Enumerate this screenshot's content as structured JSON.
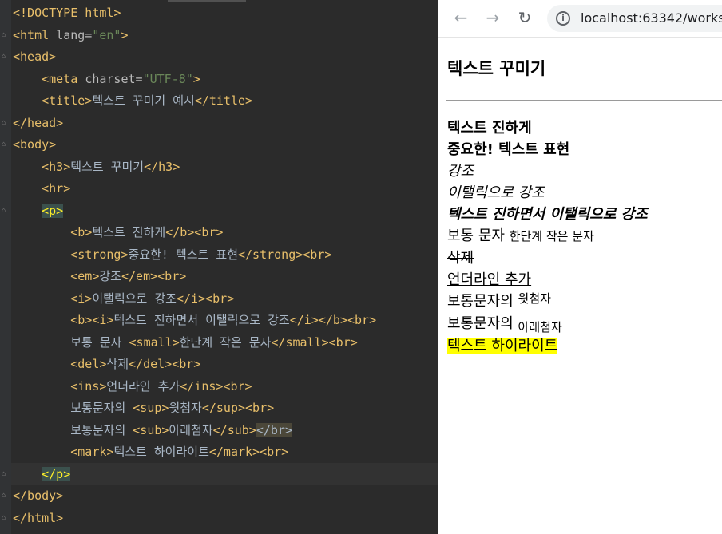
{
  "editor": {
    "lines": [
      [
        {
          "c": "tag",
          "t": "<!DOCTYPE html>"
        }
      ],
      [
        {
          "c": "tag",
          "t": "<html "
        },
        {
          "c": "attr",
          "t": "lang="
        },
        {
          "c": "val",
          "t": "\"en\""
        },
        {
          "c": "tag",
          "t": ">"
        }
      ],
      [
        {
          "c": "tag",
          "t": "<head>"
        }
      ],
      [
        {
          "c": "txt",
          "t": "    "
        },
        {
          "c": "tag",
          "t": "<meta "
        },
        {
          "c": "attr",
          "t": "charset="
        },
        {
          "c": "val",
          "t": "\"UTF-8\""
        },
        {
          "c": "tag",
          "t": ">"
        }
      ],
      [
        {
          "c": "txt",
          "t": "    "
        },
        {
          "c": "tag",
          "t": "<title>"
        },
        {
          "c": "txt",
          "t": "텍스트 꾸미기 예시"
        },
        {
          "c": "tag",
          "t": "</title>"
        }
      ],
      [
        {
          "c": "tag",
          "t": "</head>"
        }
      ],
      [
        {
          "c": "tag",
          "t": "<body>"
        }
      ],
      [
        {
          "c": "txt",
          "t": "    "
        },
        {
          "c": "tag",
          "t": "<h3>"
        },
        {
          "c": "txt",
          "t": "텍스트 꾸미기"
        },
        {
          "c": "tag",
          "t": "</h3>"
        }
      ],
      [
        {
          "c": "txt",
          "t": "    "
        },
        {
          "c": "tag",
          "t": "<hr>"
        }
      ],
      [
        {
          "c": "txt",
          "t": "    "
        },
        {
          "c": "hl-pair",
          "t": "<p>"
        }
      ],
      [
        {
          "c": "txt",
          "t": "        "
        },
        {
          "c": "tag",
          "t": "<b>"
        },
        {
          "c": "txt",
          "t": "텍스트 진하게"
        },
        {
          "c": "tag",
          "t": "</b><br>"
        }
      ],
      [
        {
          "c": "txt",
          "t": "        "
        },
        {
          "c": "tag",
          "t": "<strong>"
        },
        {
          "c": "txt",
          "t": "중요한! 텍스트 표현"
        },
        {
          "c": "tag",
          "t": "</strong><br>"
        }
      ],
      [
        {
          "c": "txt",
          "t": "        "
        },
        {
          "c": "tag",
          "t": "<em>"
        },
        {
          "c": "txt",
          "t": "강조"
        },
        {
          "c": "tag",
          "t": "</em><br>"
        }
      ],
      [
        {
          "c": "txt",
          "t": "        "
        },
        {
          "c": "tag",
          "t": "<i>"
        },
        {
          "c": "txt",
          "t": "이탤릭으로 강조"
        },
        {
          "c": "tag",
          "t": "</i><br>"
        }
      ],
      [
        {
          "c": "txt",
          "t": "        "
        },
        {
          "c": "tag",
          "t": "<b><i>"
        },
        {
          "c": "txt",
          "t": "텍스트 진하면서 이탤릭으로 강조"
        },
        {
          "c": "tag",
          "t": "</i></b><br>"
        }
      ],
      [
        {
          "c": "txt",
          "t": "        보통 문자 "
        },
        {
          "c": "tag",
          "t": "<small>"
        },
        {
          "c": "txt",
          "t": "한단계 작은 문자"
        },
        {
          "c": "tag",
          "t": "</small><br>"
        }
      ],
      [
        {
          "c": "txt",
          "t": "        "
        },
        {
          "c": "tag",
          "t": "<del>"
        },
        {
          "c": "txt",
          "t": "삭제"
        },
        {
          "c": "tag",
          "t": "</del><br>"
        }
      ],
      [
        {
          "c": "txt",
          "t": "        "
        },
        {
          "c": "tag",
          "t": "<ins>"
        },
        {
          "c": "txt",
          "t": "언더라인 추가"
        },
        {
          "c": "tag",
          "t": "</ins><br>"
        }
      ],
      [
        {
          "c": "txt",
          "t": "        보통문자의 "
        },
        {
          "c": "tag",
          "t": "<sup>"
        },
        {
          "c": "txt",
          "t": "윗첨자"
        },
        {
          "c": "tag",
          "t": "</sup><br>"
        }
      ],
      [
        {
          "c": "txt",
          "t": "        보통문자의 "
        },
        {
          "c": "tag",
          "t": "<sub>"
        },
        {
          "c": "txt",
          "t": "아래첨자"
        },
        {
          "c": "tag",
          "t": "</sub>"
        },
        {
          "c": "hl-br",
          "t": "</br>"
        }
      ],
      [
        {
          "c": "txt",
          "t": "        "
        },
        {
          "c": "tag",
          "t": "<mark>"
        },
        {
          "c": "txt",
          "t": "텍스트 하이라이트"
        },
        {
          "c": "tag",
          "t": "</mark><br>"
        }
      ],
      [
        {
          "c": "txt",
          "t": "    "
        },
        {
          "c": "hl-pair",
          "t": "</p>"
        }
      ],
      [
        {
          "c": "tag",
          "t": "</body>"
        }
      ],
      [
        {
          "c": "tag",
          "t": "</html>"
        }
      ]
    ]
  },
  "browser": {
    "back_icon": "arrow-left-icon",
    "forward_icon": "arrow-right-icon",
    "reload_icon": "reload-icon",
    "url": "localhost:63342/works",
    "heading": "텍스트 꾸미기",
    "bold_text": "텍스트 진하게",
    "strong_text": "중요한! 텍스트 표현",
    "em_text": "강조",
    "italic_text": "이탤릭으로 강조",
    "bold_italic_text": "텍스트 진하면서 이탤릭으로 강조",
    "normal_text": "보통 문자",
    "small_text": "한단계 작은 문자",
    "del_text": "삭제",
    "ins_text": "언더라인 추가",
    "sup_base": "보통문자의",
    "sup_text": "윗첨자",
    "sub_base": "보통문자의",
    "sub_text": "아래첨자",
    "mark_text": "텍스트 하이라이트",
    "mark_color": "#ffff00"
  }
}
